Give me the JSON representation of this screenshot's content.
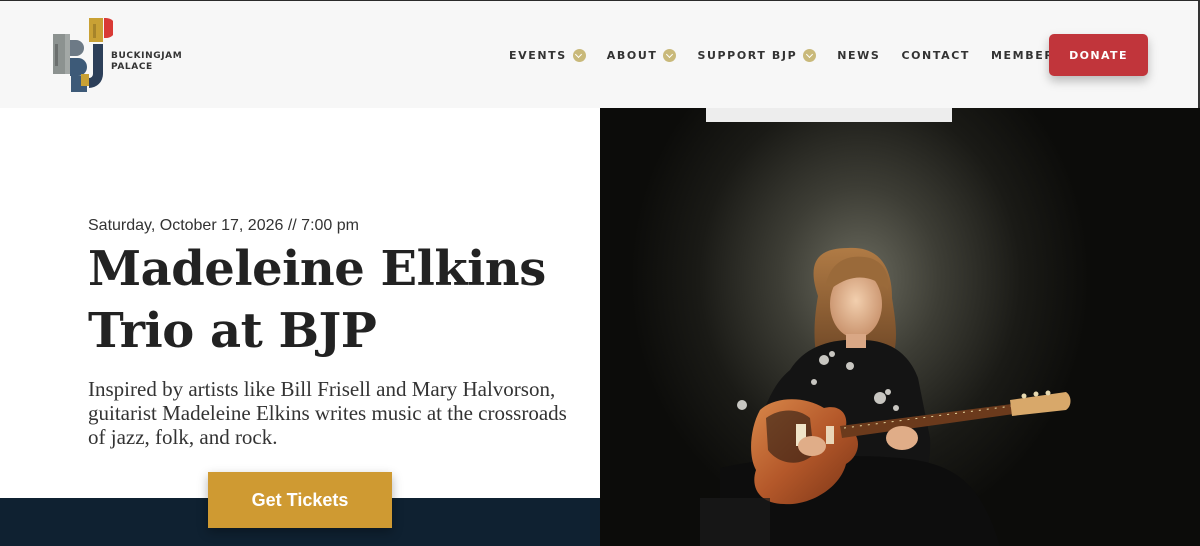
{
  "brand": {
    "line1": "BUCKINGJAM",
    "line2": "PALACE",
    "logo_letters": "BJP",
    "colors": {
      "red": "#d93a35",
      "gold": "#c9a134",
      "slate": "#3d5a78",
      "gray": "#8c9290"
    }
  },
  "nav": {
    "items": [
      {
        "label": "EVENTS",
        "has_dropdown": true
      },
      {
        "label": "ABOUT",
        "has_dropdown": true
      },
      {
        "label": "SUPPORT BJP",
        "has_dropdown": true
      },
      {
        "label": "NEWS",
        "has_dropdown": false
      },
      {
        "label": "CONTACT",
        "has_dropdown": false
      },
      {
        "label": "MEMBERSHIP",
        "has_dropdown": false
      }
    ],
    "donate_label": "DONATE",
    "donate_color": "#c1353b",
    "dropdown_icon": "chevron-down-icon"
  },
  "event": {
    "datetime": "Saturday, October 17, 2026 // 7:00 pm",
    "title_line1": "Madeleine Elkins",
    "title_line2": "Trio at BJP",
    "description": "Inspired by artists like Bill Frisell and Mary Halvorson, guitarist Madeleine Elkins writes music at the crossroads of jazz, folk, and rock.",
    "cta_label": "Get Tickets",
    "cta_color": "#cf9a32",
    "band_color": "#0f2131"
  }
}
